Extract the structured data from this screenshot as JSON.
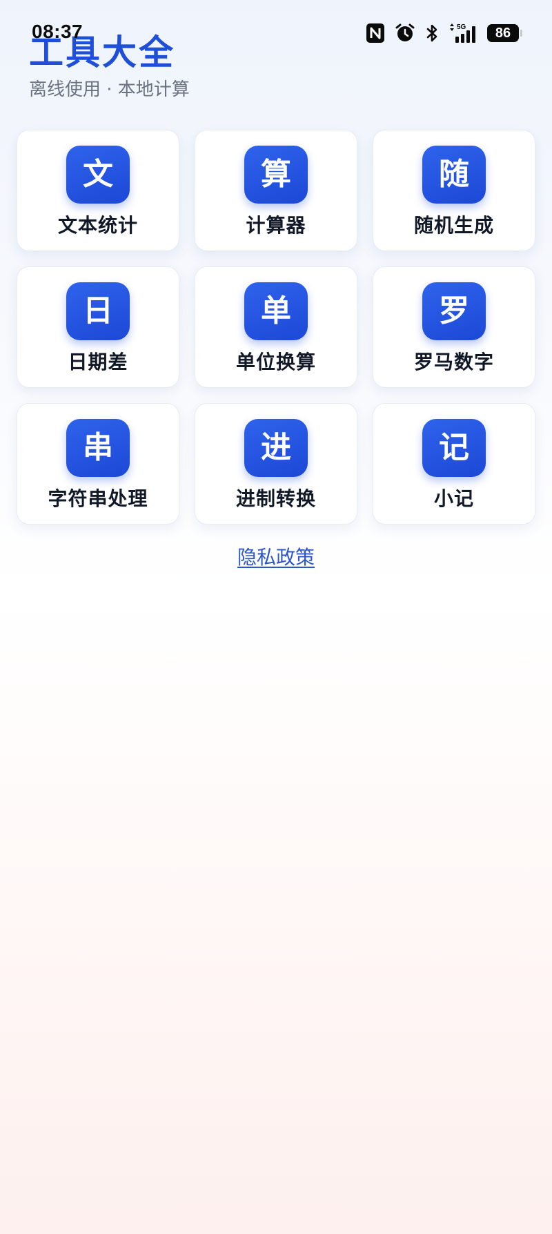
{
  "status_bar": {
    "time": "08:37",
    "icons": [
      "nfc-icon",
      "alarm-icon",
      "bluetooth-icon",
      "5g-signal-icon",
      "battery-icon"
    ],
    "network_label": "5G",
    "battery_level": "86"
  },
  "header": {
    "title": "工具大全",
    "subtitle": "离线使用 · 本地计算"
  },
  "tools": [
    {
      "glyph": "文",
      "label": "文本统计"
    },
    {
      "glyph": "算",
      "label": "计算器"
    },
    {
      "glyph": "随",
      "label": "随机生成"
    },
    {
      "glyph": "日",
      "label": "日期差"
    },
    {
      "glyph": "单",
      "label": "单位换算"
    },
    {
      "glyph": "罗",
      "label": "罗马数字"
    },
    {
      "glyph": "串",
      "label": "字符串处理"
    },
    {
      "glyph": "进",
      "label": "进制转换"
    },
    {
      "glyph": "记",
      "label": "小记"
    }
  ],
  "footer": {
    "privacy_link": "隐私政策"
  },
  "colors": {
    "accent": "#1f4fd6",
    "icon_tile": "#2459e0",
    "link": "#2d57c8",
    "subtitle": "#6b7280"
  }
}
